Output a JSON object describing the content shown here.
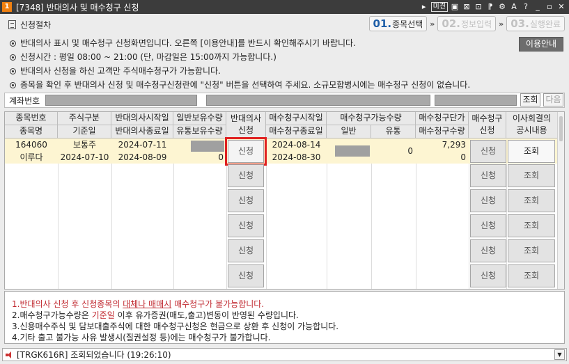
{
  "window": {
    "number": "1",
    "title": "[7348] 반대의사 및 매수청구 신청",
    "toolbar_icons": [
      "play-icon",
      "memo-icon",
      "pin-icon",
      "maximize-box-icon",
      "camera-icon",
      "bookmark-icon",
      "settings-icon",
      "text-size-icon",
      "help-icon",
      "minimize-icon",
      "restore-icon",
      "close-icon"
    ],
    "toolbar_glyphs": [
      "▸",
      "미견",
      "▣",
      "⊠",
      "⊡",
      "⁋",
      "⚙",
      "A",
      "?",
      "_",
      "▫",
      "✕"
    ]
  },
  "process": {
    "title": "신청절차",
    "steps": [
      {
        "num": "01.",
        "label": "종목선택"
      },
      {
        "num": "02.",
        "label": "정보입력"
      },
      {
        "num": "03.",
        "label": "실행완료"
      }
    ],
    "arrow": "»"
  },
  "notices": [
    "반대의사 표시 및 매수청구 신청화면입니다. 오른쪽 [이용안내]를 반드시 확인해주시기 바랍니다.",
    "신청시간 : 평일 08:00 ~ 21:00 (단, 마감일은 15:00까지 가능합니다.)",
    "반대의사 신청을 하신 고객만 주식매수청구가 가능합니다.",
    "종목을 확인 후 반대의사 신청 및 매수청구신청란에 \"신청\" 버튼을 선택하여 주세요. 소규모합병시에는 매수청구 신청이 없습니다."
  ],
  "guide_button": "이용안내",
  "account": {
    "label": "계좌번호",
    "lookup": "조회",
    "next": "다음"
  },
  "grid": {
    "headers": {
      "code": "종목번호",
      "name": "종목명",
      "stock_type": "주식구분",
      "base_date": "기준일",
      "objection_start": "반대의사시작일",
      "objection_end": "반대의사종료일",
      "general_qty": "일반보유수량",
      "float_qty": "유통보유수량",
      "objection_l1": "반대의사",
      "objection_l2": "신청",
      "purchase_start": "매수청구시작일",
      "purchase_end": "매수청구종료일",
      "claimable_qty": "매수청구가능수량",
      "claimable_general": "일반",
      "claimable_float": "유통",
      "unit_price": "매수청구단가",
      "purchase_qty": "매수청구수량",
      "purchase_req_l1": "매수청구",
      "purchase_req_l2": "신청",
      "board_l1": "이사회결의",
      "board_l2": "공시내용"
    },
    "row": {
      "code": "164060",
      "name": "이루다",
      "stock_type": "보통주",
      "base_date": "2024-07-10",
      "objection_start": "2024-07-11",
      "objection_end": "2024-08-09",
      "float_qty": "0",
      "purchase_start": "2024-08-14",
      "purchase_end": "2024-08-30",
      "claimable_float": "0",
      "unit_price": "7,293",
      "purchase_qty": "0"
    },
    "apply_label": "신청",
    "view_label": "조회"
  },
  "footnotes": {
    "n1_pre": "1.반대의사 신청 후 신청종목의 ",
    "n1_u": "대체나 매매시",
    "n1_post": " 매수청구가 불가능합니다.",
    "n2_pre": "2.매수청구가능수량은 ",
    "n2_hl": "기준일",
    "n2_post": " 이후 유가증권(매도,출고)변동이 반영된 수량입니다.",
    "n3": "3.신용매수주식 및 담보대출주식에 대한 매수청구신청은 현금으로 상환 후 신청이 가능합니다.",
    "n4": "4.기타 출고 불가능 사유 발생시(질권설정 등)에는 매수청구가 불가합니다."
  },
  "status": {
    "text": "[TRGK616R] 조회되었습니다 (19:26:10)",
    "dropdown": "▼"
  },
  "colors": {
    "titlebar": "#3c3c3c",
    "row_highlight": "#fdf5d2",
    "selection_outline": "#e02020",
    "step_active": "#1f5fa8",
    "footnote_red": "#c0282f"
  }
}
